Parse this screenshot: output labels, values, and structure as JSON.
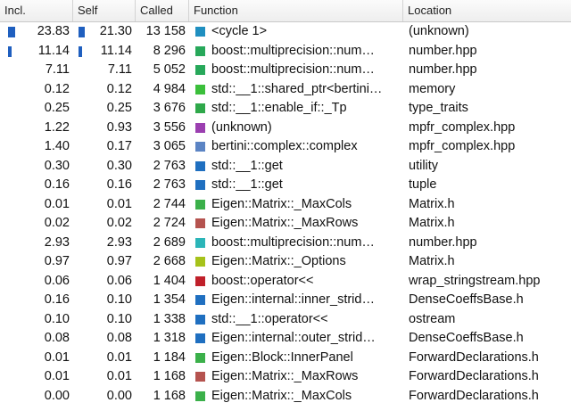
{
  "headers": {
    "incl": "Incl.",
    "self": "Self",
    "called": "Called",
    "function": "Function",
    "location": "Location"
  },
  "rows": [
    {
      "incl": "23.83",
      "self": "21.30",
      "called": "13 158",
      "function": "<cycle 1>",
      "location": "(unknown)",
      "color": "#1f8fc0",
      "incl_frac": 0.2383,
      "self_frac": 0.213
    },
    {
      "incl": "11.14",
      "self": "11.14",
      "called": "8 296",
      "function": "boost::multiprecision::num…",
      "location": "number.hpp",
      "color": "#27a85a",
      "incl_frac": 0.1114,
      "self_frac": 0.1114
    },
    {
      "incl": "7.11",
      "self": "7.11",
      "called": "5 052",
      "function": "boost::multiprecision::num…",
      "location": "number.hpp",
      "color": "#27a85a"
    },
    {
      "incl": "0.12",
      "self": "0.12",
      "called": "4 984",
      "function": "std::__1::shared_ptr<bertini…",
      "location": "memory",
      "color": "#3bbf3b"
    },
    {
      "incl": "0.25",
      "self": "0.25",
      "called": "3 676",
      "function": "std::__1::enable_if::_Tp",
      "location": "type_traits",
      "color": "#2fa84a"
    },
    {
      "incl": "1.22",
      "self": "0.93",
      "called": "3 556",
      "function": "(unknown)",
      "location": "mpfr_complex.hpp",
      "color": "#9b3fb0"
    },
    {
      "incl": "1.40",
      "self": "0.17",
      "called": "3 065",
      "function": "bertini::complex::complex",
      "location": "mpfr_complex.hpp",
      "color": "#5b84c4"
    },
    {
      "incl": "0.30",
      "self": "0.30",
      "called": "2 763",
      "function": "std::__1::get",
      "location": "utility",
      "color": "#1f6fc0"
    },
    {
      "incl": "0.16",
      "self": "0.16",
      "called": "2 763",
      "function": "std::__1::get",
      "location": "tuple",
      "color": "#1f6fc0"
    },
    {
      "incl": "0.01",
      "self": "0.01",
      "called": "2 744",
      "function": "Eigen::Matrix::_MaxCols",
      "location": "Matrix.h",
      "color": "#3bb04a"
    },
    {
      "incl": "0.02",
      "self": "0.02",
      "called": "2 724",
      "function": "Eigen::Matrix::_MaxRows",
      "location": "Matrix.h",
      "color": "#b5534f"
    },
    {
      "incl": "2.93",
      "self": "2.93",
      "called": "2 689",
      "function": "boost::multiprecision::num…",
      "location": "number.hpp",
      "color": "#2bb5b8"
    },
    {
      "incl": "0.97",
      "self": "0.97",
      "called": "2 668",
      "function": "Eigen::Matrix::_Options",
      "location": "Matrix.h",
      "color": "#a6c21a"
    },
    {
      "incl": "0.06",
      "self": "0.06",
      "called": "1 404",
      "function": "boost::operator<<",
      "location": "wrap_stringstream.hpp",
      "color": "#c0202a"
    },
    {
      "incl": "0.16",
      "self": "0.10",
      "called": "1 354",
      "function": "Eigen::internal::inner_strid…",
      "location": "DenseCoeffsBase.h",
      "color": "#1f6fc0"
    },
    {
      "incl": "0.10",
      "self": "0.10",
      "called": "1 338",
      "function": "std::__1::operator<<",
      "location": "ostream",
      "color": "#1f6fc0"
    },
    {
      "incl": "0.08",
      "self": "0.08",
      "called": "1 318",
      "function": "Eigen::internal::outer_strid…",
      "location": "DenseCoeffsBase.h",
      "color": "#1f6fc0"
    },
    {
      "incl": "0.01",
      "self": "0.01",
      "called": "1 184",
      "function": "Eigen::Block::InnerPanel",
      "location": "ForwardDeclarations.h",
      "color": "#3bb04a"
    },
    {
      "incl": "0.01",
      "self": "0.01",
      "called": "1 168",
      "function": "Eigen::Matrix::_MaxRows",
      "location": "ForwardDeclarations.h",
      "color": "#b5534f"
    },
    {
      "incl": "0.00",
      "self": "0.00",
      "called": "1 168",
      "function": "Eigen::Matrix::_MaxCols",
      "location": "ForwardDeclarations.h",
      "color": "#3bb04a"
    }
  ]
}
